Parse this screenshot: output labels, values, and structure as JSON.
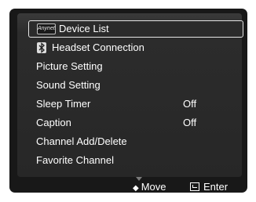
{
  "menu": {
    "items": [
      {
        "label": "Device List",
        "value": "",
        "icon": "anynet-logo-icon",
        "icon_text": "Anynet+",
        "selected": true
      },
      {
        "label": "Headset Connection",
        "value": "",
        "icon": "bluetooth-icon",
        "selected": false
      },
      {
        "label": "Picture Setting",
        "value": "",
        "selected": false
      },
      {
        "label": "Sound Setting",
        "value": "",
        "selected": false
      },
      {
        "label": "Sleep Timer",
        "value": "Off",
        "selected": false
      },
      {
        "label": "Caption",
        "value": "Off",
        "selected": false
      },
      {
        "label": "Channel Add/Delete",
        "value": "",
        "selected": false
      },
      {
        "label": "Favorite Channel",
        "value": "",
        "selected": false
      }
    ],
    "scroll_indicator": "down-arrow-icon"
  },
  "footer": {
    "move_label": "Move",
    "move_icon": "up-down-arrow-icon",
    "enter_label": "Enter",
    "enter_icon": "enter-icon"
  },
  "colors": {
    "panel_background": "#272727",
    "frame_background": "#181818",
    "text": "#ffffff",
    "selection_border": "#e6e6e6"
  }
}
